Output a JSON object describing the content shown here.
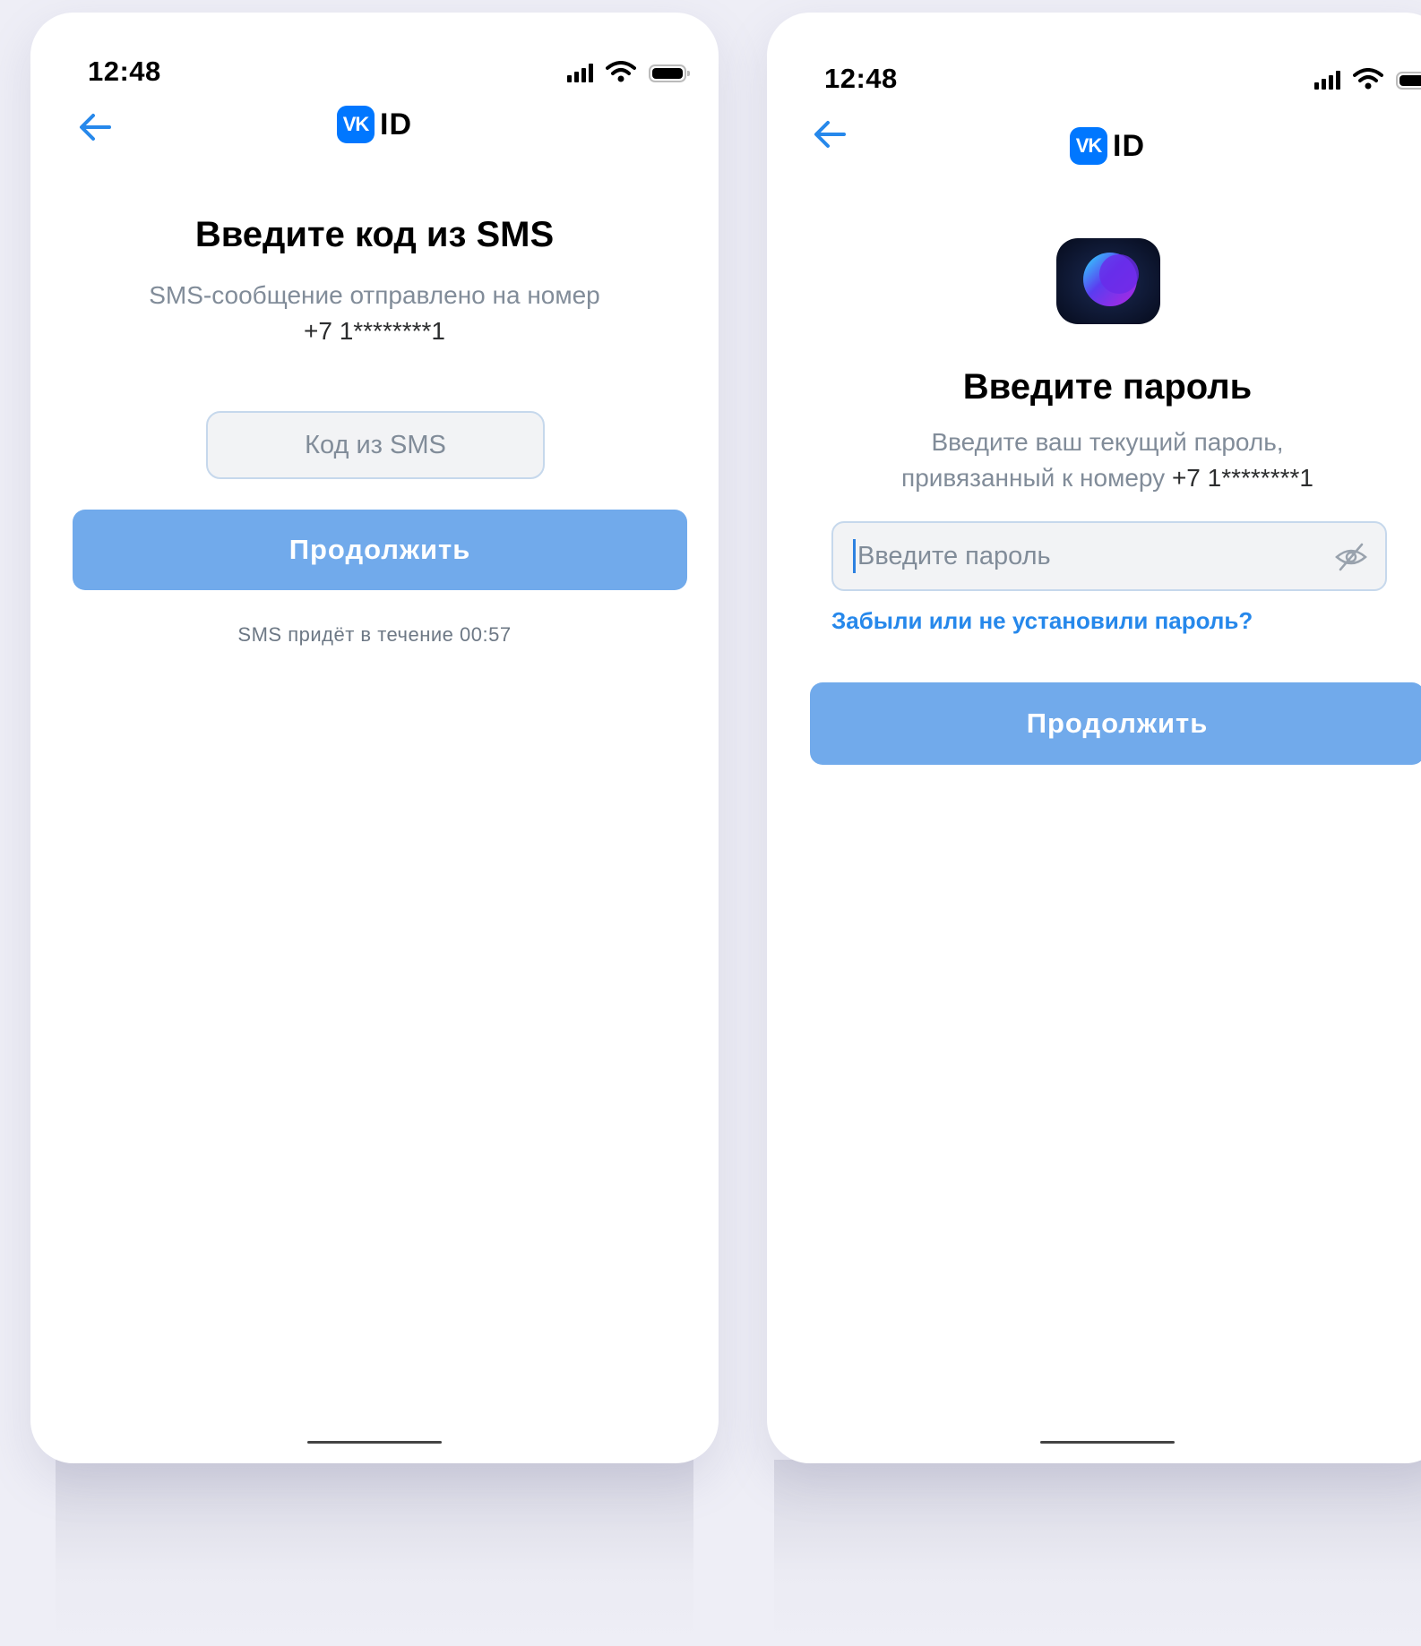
{
  "screen_sms": {
    "status_time": "12:48",
    "logo_text": "ID",
    "vk_badge": "VK",
    "title": "Введите код из SMS",
    "subtitle_line1": "SMS-сообщение отправлено на номер",
    "subtitle_phone": "+7 1********1",
    "code_placeholder": "Код из SMS",
    "continue_label": "Продолжить",
    "timer_text": "SMS придёт в течение 00:57"
  },
  "screen_password": {
    "status_time": "12:48",
    "logo_text": "ID",
    "vk_badge": "VK",
    "title": "Введите пароль",
    "subtitle_line1": "Введите ваш текущий пароль,",
    "subtitle_line2": "привязанный к номеру",
    "subtitle_phone": "+7 1********1",
    "password_placeholder": "Введите пароль",
    "forgot_link": "Забыли или не установили пароль?",
    "continue_label": "Продолжить"
  },
  "colors": {
    "accent": "#0077ff",
    "button": "#71aaeb",
    "link": "#2688eb",
    "secondary_text": "#818c99"
  }
}
